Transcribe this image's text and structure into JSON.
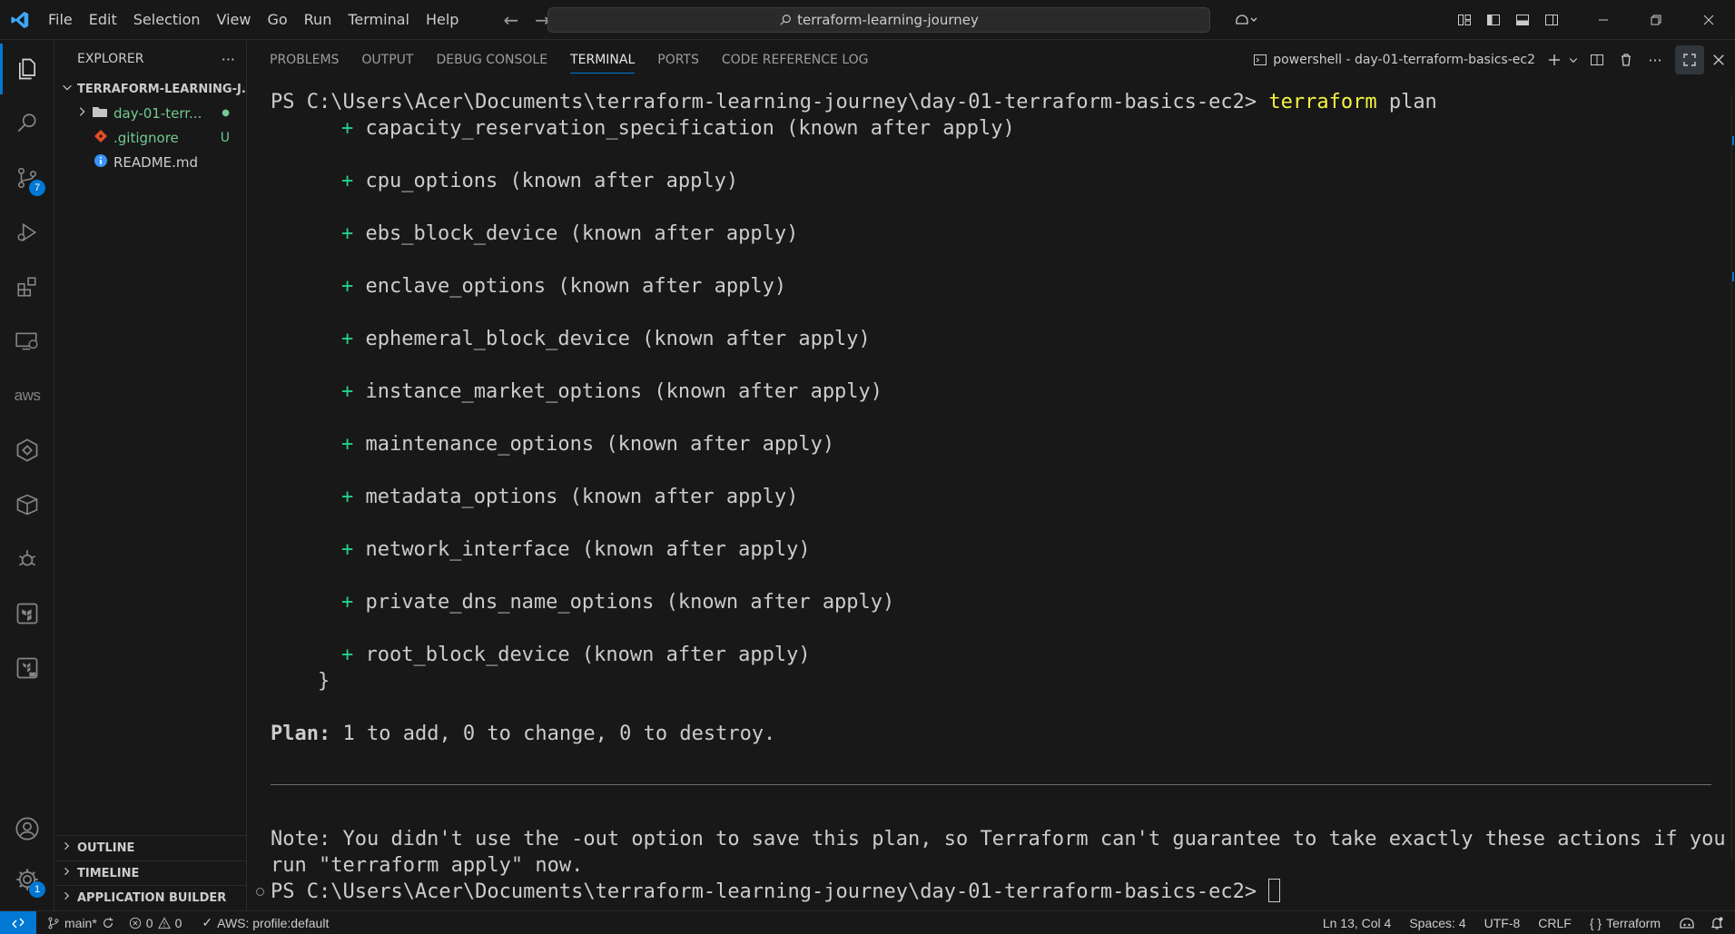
{
  "titlebar": {
    "menu": [
      "File",
      "Edit",
      "Selection",
      "View",
      "Go",
      "Run",
      "Terminal",
      "Help"
    ],
    "search_text": "terraform-learning-journey"
  },
  "activity": {
    "scm_badge": "7",
    "settings_badge": "1",
    "aws_label": "aws"
  },
  "sidebar": {
    "title": "EXPLORER",
    "root": "TERRAFORM-LEARNING-J...",
    "items": [
      {
        "label": "day-01-terr...",
        "decoration": "●"
      },
      {
        "label": ".gitignore",
        "decoration": "U"
      },
      {
        "label": "README.md",
        "decoration": ""
      }
    ],
    "sections": [
      "OUTLINE",
      "TIMELINE",
      "APPLICATION BUILDER"
    ]
  },
  "panel": {
    "tabs": [
      "PROBLEMS",
      "OUTPUT",
      "DEBUG CONSOLE",
      "TERMINAL",
      "PORTS",
      "CODE REFERENCE LOG"
    ],
    "active_tab": "TERMINAL",
    "shell_name": "powershell - day-01-terraform-basics-ec2"
  },
  "terminal": {
    "prompt": "PS C:\\Users\\Acer\\Documents\\terraform-learning-journey\\day-01-terraform-basics-ec2> ",
    "cmd_tool": "terraform",
    "cmd_args": " plan",
    "plus": "+",
    "attributes": [
      "capacity_reservation_specification (known after apply)",
      "cpu_options (known after apply)",
      "ebs_block_device (known after apply)",
      "enclave_options (known after apply)",
      "ephemeral_block_device (known after apply)",
      "instance_market_options (known after apply)",
      "maintenance_options (known after apply)",
      "metadata_options (known after apply)",
      "network_interface (known after apply)",
      "private_dns_name_options (known after apply)",
      "root_block_device (known after apply)"
    ],
    "close_brace": "}",
    "plan_label": "Plan:",
    "plan_summary": " 1 to add, 0 to change, 0 to destroy.",
    "note_line1": "Note: You didn't use the -out option to save this plan, so Terraform can't guarantee to take exactly these actions if you",
    "note_line2": "run \"terraform apply\" now.",
    "final_prompt": "PS C:\\Users\\Acer\\Documents\\terraform-learning-journey\\day-01-terraform-basics-ec2> "
  },
  "statusbar": {
    "branch": "main*",
    "errors": "0",
    "warnings": "0",
    "aws_profile": "AWS: profile:default",
    "position": "Ln 13, Col 4",
    "spaces": "Spaces: 4",
    "encoding": "UTF-8",
    "eol": "CRLF",
    "language": "Terraform"
  },
  "colors": {
    "accent": "#0078d4",
    "added": "#23d18b",
    "command": "#f5f543",
    "git_untracked": "#73c991",
    "git_modified_dot": "#73c991"
  }
}
